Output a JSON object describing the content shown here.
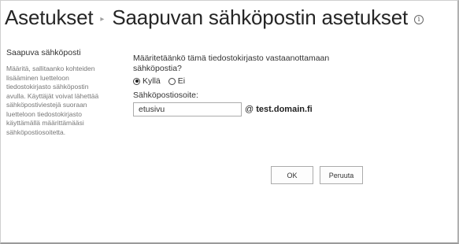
{
  "header": {
    "breadcrumb_parent": "Asetukset",
    "separator": "▸",
    "title": "Saapuvan sähköpostin asetukset",
    "info_glyph": "i"
  },
  "section": {
    "title": "Saapuva sähköposti",
    "description": "Määritä, sallitaanko kohteiden lisääminen luetteloon tiedostokirjasto sähköpostin avulla. Käyttäjät voivat lähettää sähköpostiviestejä suoraan luetteloon tiedostokirjasto käyttämällä määrittämääsi sähköpostiosoitetta."
  },
  "form": {
    "question": "Määritetäänkö tämä tiedostokirjasto vastaanottamaan sähköpostia?",
    "options": [
      {
        "label": "Kyllä",
        "checked": true
      },
      {
        "label": "Ei",
        "checked": false
      }
    ],
    "email_label": "Sähköpostiosoite:",
    "email_value": "etusivu",
    "at_sign": "@",
    "domain": "test.domain.fi"
  },
  "buttons": {
    "ok": "OK",
    "cancel": "Peruuta"
  }
}
